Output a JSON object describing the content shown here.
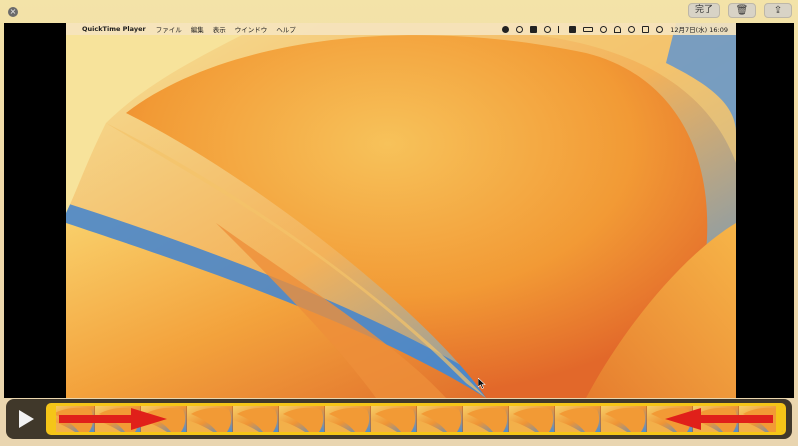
{
  "toolbar": {
    "close_glyph": "×",
    "done_label": "完了",
    "delete_glyph": "🗑",
    "share_glyph": "⇪"
  },
  "menubar": {
    "apple_glyph": "",
    "app_name": "QuickTime Player",
    "menus": [
      "ファイル",
      "編集",
      "表示",
      "ウインドウ",
      "ヘルプ"
    ],
    "clock": "12月7日(水) 16:09"
  },
  "player": {
    "play_icon": "play-icon",
    "fullscreen_glyph": "⛶"
  },
  "colors": {
    "trim_handle": "#f5c518",
    "annotation_arrow": "#e0201a",
    "wallpaper_orange": "#f08a2a",
    "wallpaper_blue": "#4a8fd6"
  }
}
